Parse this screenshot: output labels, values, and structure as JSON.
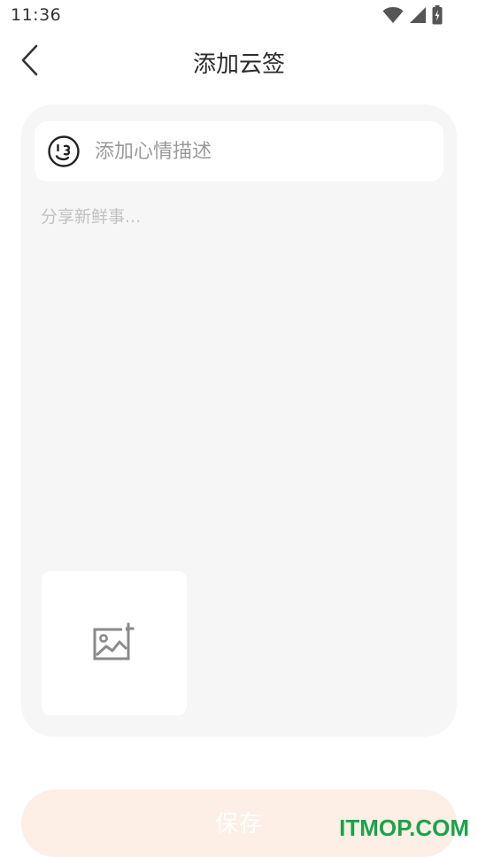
{
  "status_bar": {
    "time": "11:36",
    "icons": [
      "wifi-icon",
      "cellular-signal-icon",
      "battery-charging-icon"
    ]
  },
  "header": {
    "back_icon": "chevron-left-icon",
    "title": "添加云签"
  },
  "card": {
    "mood": {
      "icon": "wink-face-icon",
      "placeholder": "添加心情描述",
      "value": ""
    },
    "content": {
      "placeholder": "分享新鲜事...",
      "value": ""
    },
    "add_image_icon": "add-image-icon"
  },
  "save_button": {
    "label": "保存"
  },
  "watermark": {
    "text": "ITMOP.COM"
  },
  "colors": {
    "card_background": "#f6f6f6",
    "save_button_background": "#fdeee6",
    "placeholder_text": "#9a9a9a",
    "watermark": "#1aa34a"
  }
}
